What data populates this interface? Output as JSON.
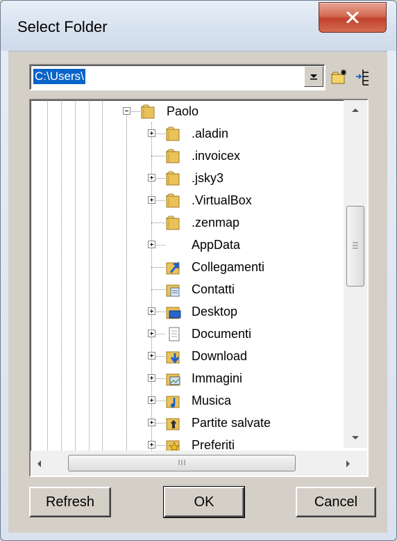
{
  "window": {
    "title": "Select Folder"
  },
  "path": {
    "value": "C:\\Users\\"
  },
  "toolbar": {
    "new_folder_icon": "new-folder-icon",
    "tree_icon": "tree-view-icon"
  },
  "tree": {
    "items": [
      {
        "label": "Paolo",
        "expander": "minus",
        "icon": "folder"
      },
      {
        "label": ".aladin",
        "expander": "plus",
        "icon": "folder"
      },
      {
        "label": ".invoicex",
        "expander": "none",
        "icon": "folder"
      },
      {
        "label": ".jsky3",
        "expander": "plus",
        "icon": "folder"
      },
      {
        "label": ".VirtualBox",
        "expander": "plus",
        "icon": "folder"
      },
      {
        "label": ".zenmap",
        "expander": "none",
        "icon": "folder"
      },
      {
        "label": "AppData",
        "expander": "plus",
        "icon": "none"
      },
      {
        "label": "Collegamenti",
        "expander": "none",
        "icon": "links-folder"
      },
      {
        "label": "Contatti",
        "expander": "none",
        "icon": "contacts-folder"
      },
      {
        "label": "Desktop",
        "expander": "plus",
        "icon": "desktop-folder"
      },
      {
        "label": "Documenti",
        "expander": "plus",
        "icon": "documents-folder"
      },
      {
        "label": "Download",
        "expander": "plus",
        "icon": "downloads-folder"
      },
      {
        "label": "Immagini",
        "expander": "plus",
        "icon": "pictures-folder"
      },
      {
        "label": "Musica",
        "expander": "plus",
        "icon": "music-folder"
      },
      {
        "label": "Partite salvate",
        "expander": "plus",
        "icon": "saved-games-folder"
      },
      {
        "label": "Preferiti",
        "expander": "plus",
        "icon": "favorites-folder"
      }
    ]
  },
  "buttons": {
    "refresh": "Refresh",
    "ok": "OK",
    "cancel": "Cancel"
  },
  "colors": {
    "selection": "#0a64c8",
    "close_button": "#c2422c",
    "dialog_face": "#d4d0c8"
  }
}
